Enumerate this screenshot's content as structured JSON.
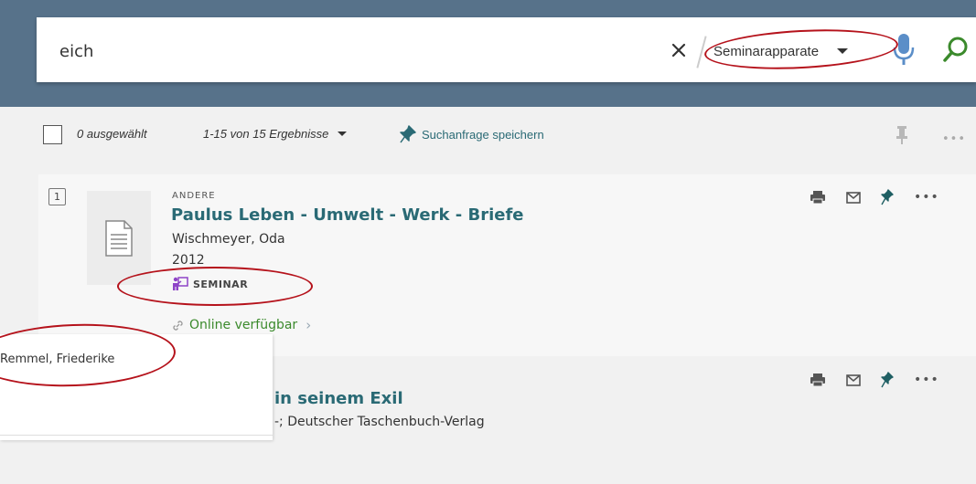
{
  "search": {
    "query": "eich",
    "scope": "Seminarapparate",
    "clear_icon": "close-icon",
    "mic_icon": "microphone-icon",
    "search_icon": "search-icon"
  },
  "toolbar": {
    "selected": "0 ausgewählt",
    "range": "1-15 von 15 Ergebnisse",
    "save_query": "Suchanfrage speichern"
  },
  "results": [
    {
      "number": "1",
      "type": "ANDERE",
      "title": "Paulus Leben - Umwelt - Werk - Briefe",
      "author": "Wischmeyer, Oda",
      "year": "2012",
      "badge": "SEMINAR",
      "availability": "Online verfügbar"
    },
    {
      "title_fragment": "in seinem Exil",
      "author_fragment": "-; Deutscher Taschenbuch-Verlag"
    }
  ],
  "overlay": {
    "item": "Remmel, Friederike"
  },
  "colors": {
    "header": "#57728a",
    "link": "#2a6a75",
    "available": "#3b8a2c",
    "annotation": "#b5121b",
    "seminar_icon": "#8e44c7"
  }
}
